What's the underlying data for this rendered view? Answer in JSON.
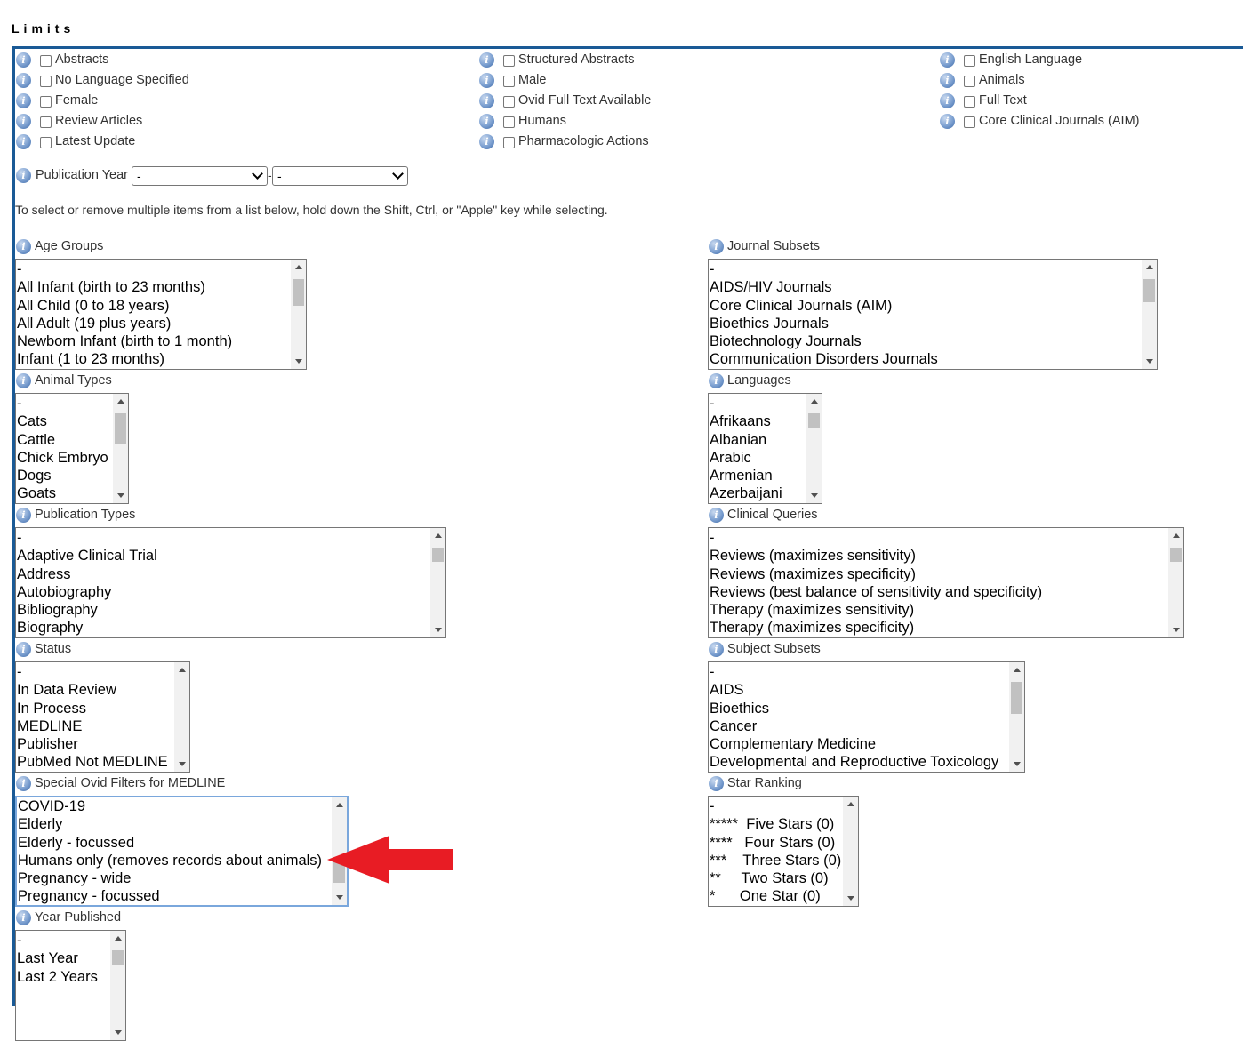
{
  "header": {
    "title": "Limits"
  },
  "checkboxes": {
    "col1": [
      "Abstracts",
      "No Language Specified",
      "Female",
      "Review Articles",
      "Latest Update"
    ],
    "col2": [
      "Structured Abstracts",
      "Male",
      "Ovid Full Text Available",
      "Humans",
      "Pharmacologic Actions"
    ],
    "col3": [
      "English Language",
      "Animals",
      "Full Text",
      "Core Clinical Journals (AIM)"
    ]
  },
  "publication_year": {
    "label": "Publication Year",
    "from_value": "-",
    "separator": "-",
    "to_value": "-"
  },
  "instructions": "To select or remove multiple items from a list below, hold down the Shift, Ctrl, or \"Apple\" key while selecting.",
  "lists": {
    "age_groups": {
      "label": "Age Groups",
      "options": [
        "-",
        "All Infant (birth to 23 months)",
        "All Child (0 to 18 years)",
        "All Adult (19 plus years)",
        "Newborn Infant (birth to 1 month)",
        "Infant (1 to 23 months)"
      ]
    },
    "journal_subsets": {
      "label": "Journal Subsets",
      "options": [
        "-",
        "AIDS/HIV Journals",
        "Core Clinical Journals (AIM)",
        "Bioethics Journals",
        "Biotechnology Journals",
        "Communication Disorders Journals"
      ]
    },
    "animal_types": {
      "label": "Animal Types",
      "options": [
        "-",
        "Cats",
        "Cattle",
        "Chick Embryo",
        "Dogs",
        "Goats"
      ]
    },
    "languages": {
      "label": "Languages",
      "options": [
        "-",
        "Afrikaans",
        "Albanian",
        "Arabic",
        "Armenian",
        "Azerbaijani"
      ]
    },
    "publication_types": {
      "label": "Publication Types",
      "options": [
        "-",
        "Adaptive Clinical Trial",
        "Address",
        "Autobiography",
        "Bibliography",
        "Biography"
      ]
    },
    "clinical_queries": {
      "label": "Clinical Queries",
      "options": [
        "-",
        "Reviews (maximizes sensitivity)",
        "Reviews (maximizes specificity)",
        "Reviews (best balance of sensitivity and specificity)",
        "Therapy (maximizes sensitivity)",
        "Therapy (maximizes specificity)"
      ]
    },
    "status": {
      "label": "Status",
      "options": [
        "-",
        "In Data Review",
        "In Process",
        "MEDLINE",
        "Publisher",
        "PubMed Not MEDLINE"
      ]
    },
    "subject_subsets": {
      "label": "Subject Subsets",
      "options": [
        "-",
        "AIDS",
        "Bioethics",
        "Cancer",
        "Complementary Medicine",
        "Developmental and Reproductive Toxicology"
      ]
    },
    "special_filters": {
      "label": "Special Ovid Filters for MEDLINE",
      "options": [
        "COVID-19",
        "Elderly",
        "Elderly - focussed",
        "Humans only (removes records about animals)",
        "Pregnancy - wide",
        "Pregnancy - focussed"
      ]
    },
    "star_ranking": {
      "label": "Star Ranking",
      "options": [
        "-",
        "*****  Five Stars (0)",
        "****   Four Stars (0)",
        "***    Three Stars (0)",
        "**     Two Stars (0)",
        "*      One Star (0)"
      ]
    },
    "year_published": {
      "label": "Year Published",
      "options": [
        "-",
        "Last Year",
        "Last 2 Years"
      ]
    }
  },
  "colors": {
    "panel_border": "#1a5a96",
    "annotation_arrow": "#e81c24",
    "focus_border": "#7aa7dc"
  },
  "icons": {
    "info": "info-icon",
    "arrow": "red-arrow-left-icon"
  }
}
